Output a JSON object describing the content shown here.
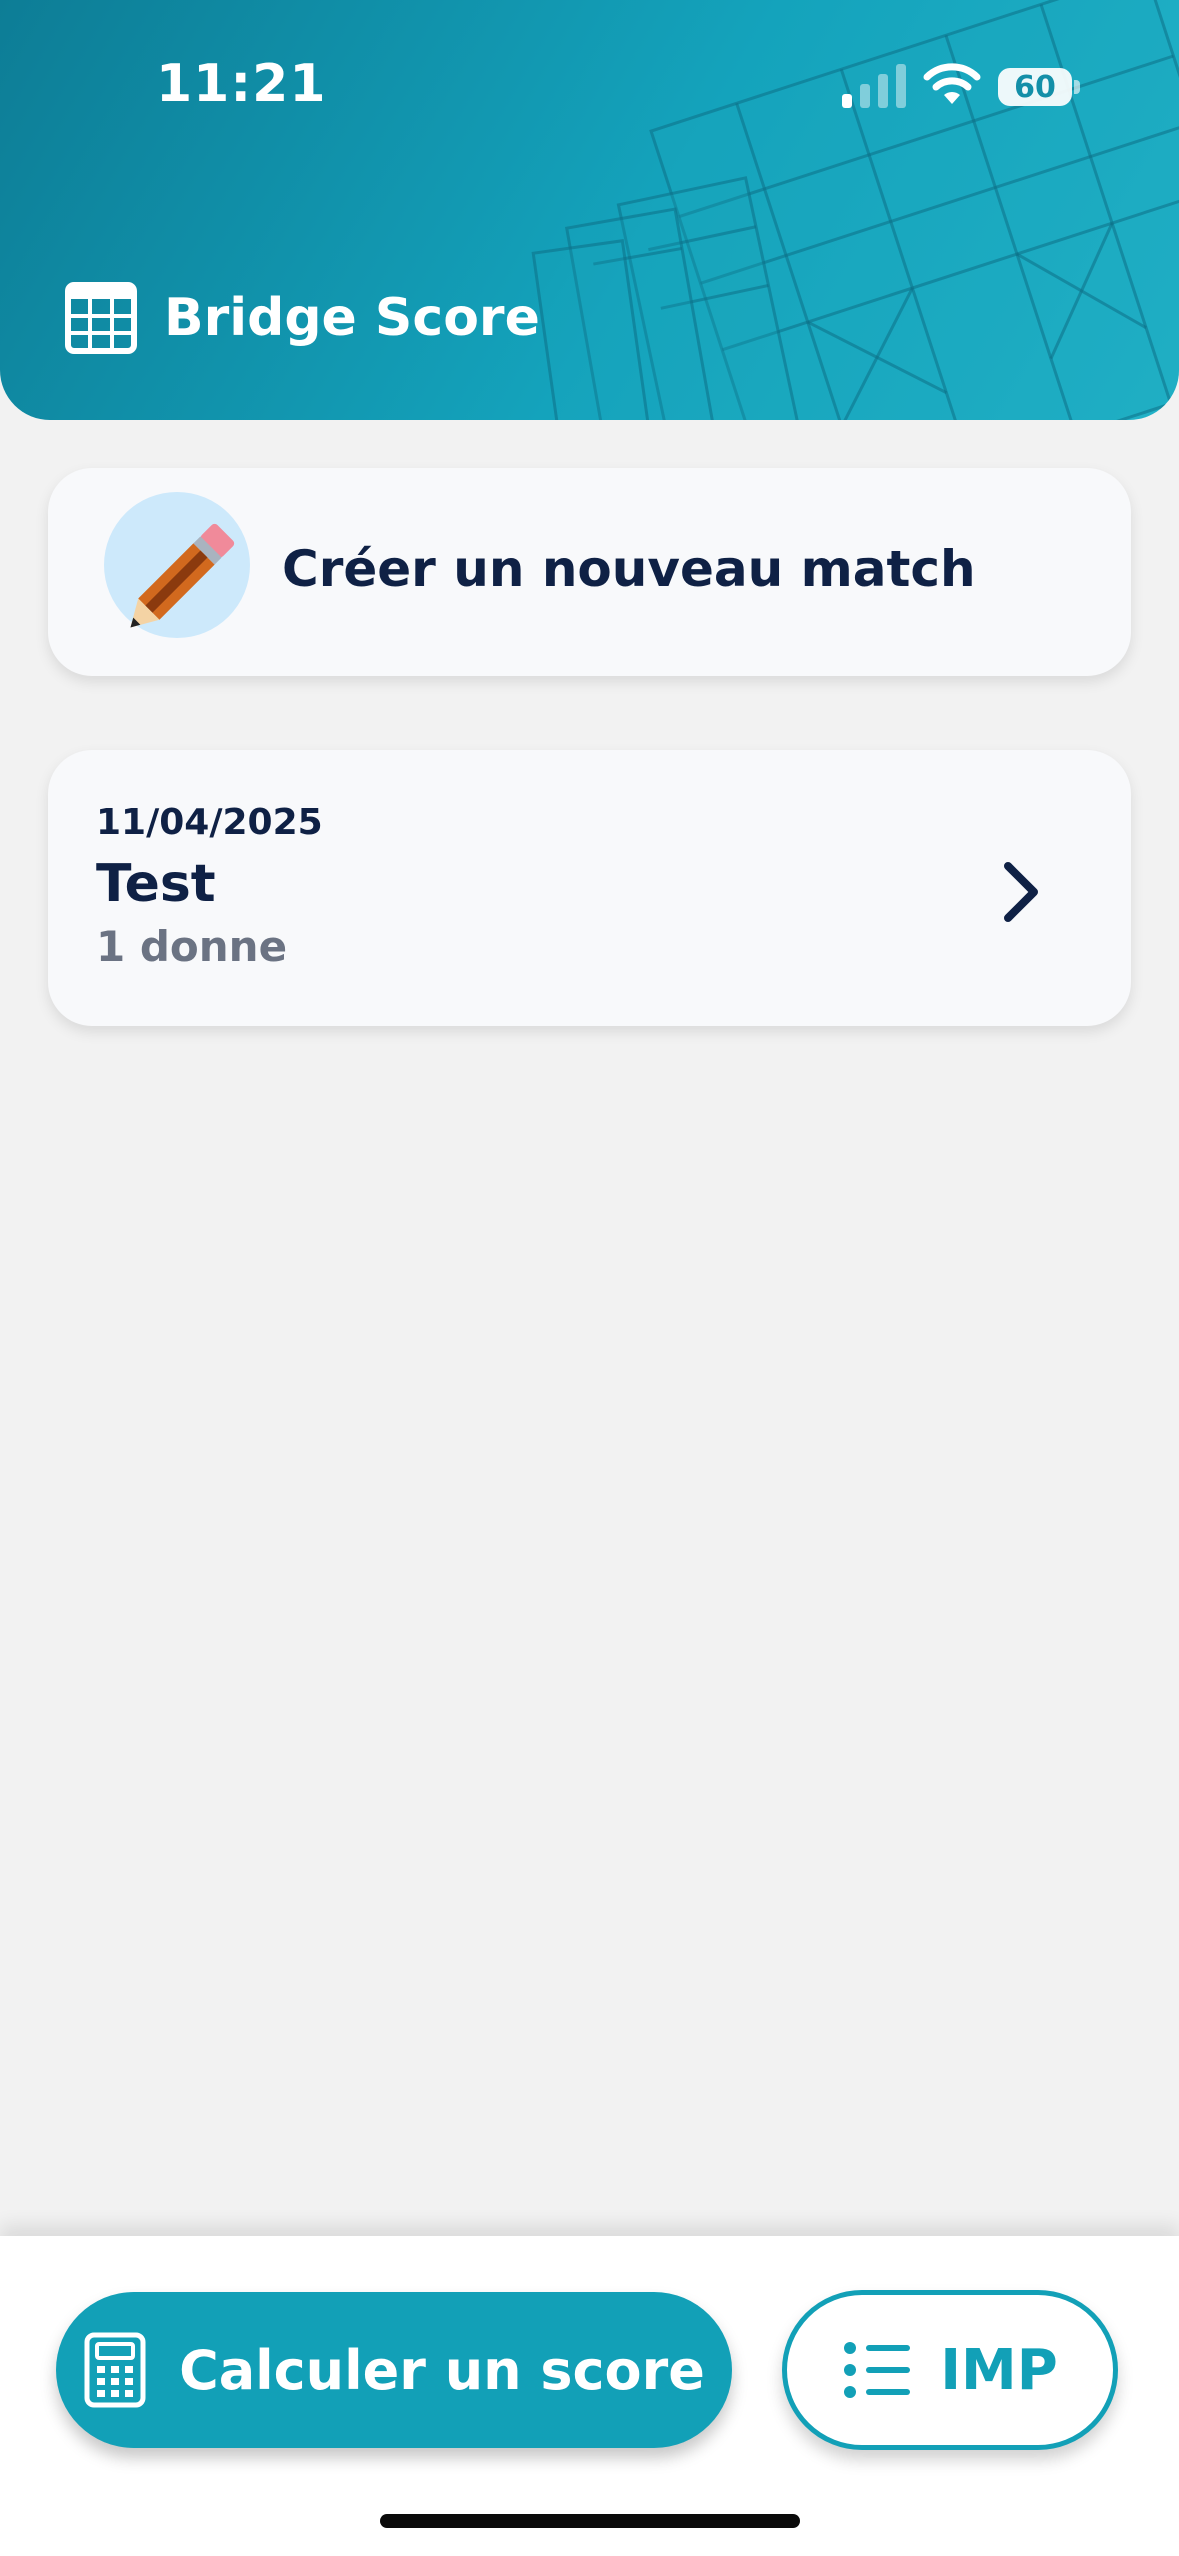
{
  "status_bar": {
    "time": "11:21",
    "battery": "60"
  },
  "header": {
    "title": "Bridge Score",
    "icon": "grid-calendar-icon"
  },
  "create_card": {
    "label": "Créer un nouveau match",
    "icon": "pencil-icon"
  },
  "matches": [
    {
      "date": "11/04/2025",
      "name": "Test",
      "count": "1 donne"
    }
  ],
  "bottom_bar": {
    "calc_label": "Calculer un score",
    "calc_icon": "calculator-icon",
    "imp_label": "IMP",
    "imp_icon": "list-icon"
  },
  "colors": {
    "accent": "#12a0b7",
    "header_dark": "#0d7d96",
    "text_dark": "#0f2145",
    "text_muted": "#6b7383",
    "background": "#f2f2f2"
  }
}
